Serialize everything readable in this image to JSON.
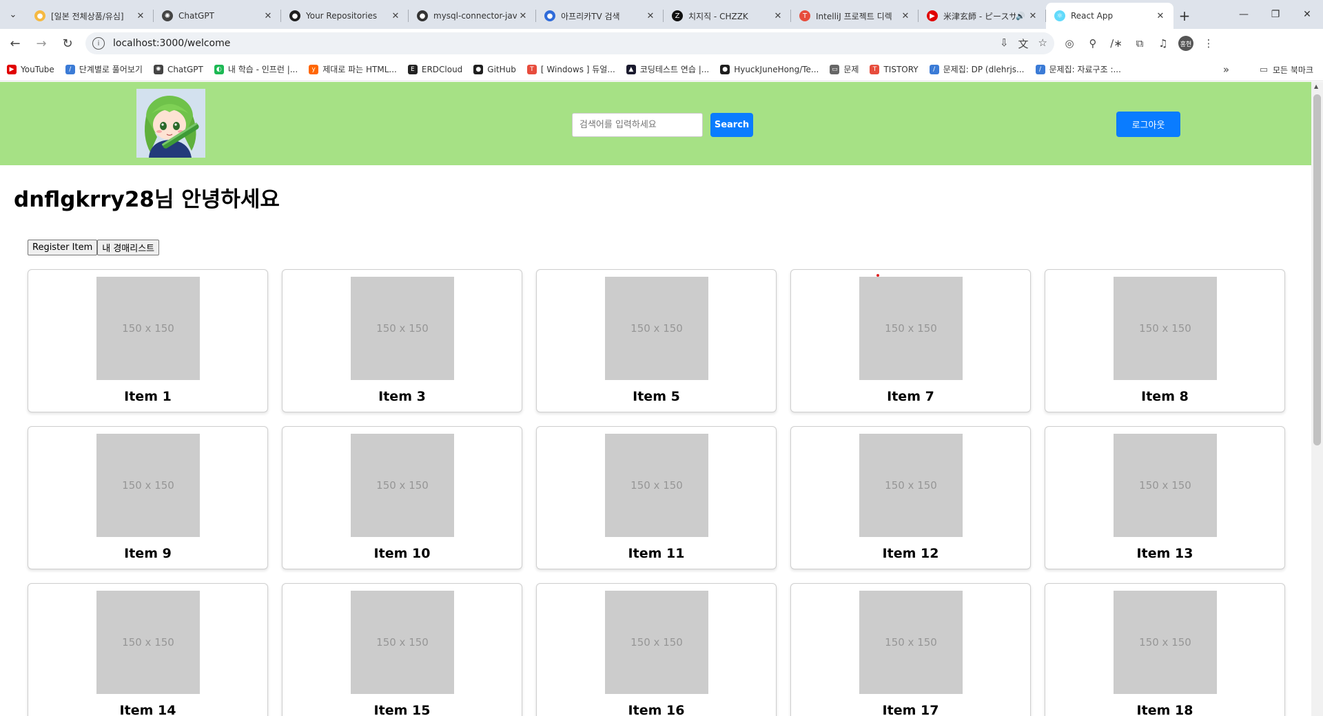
{
  "browser": {
    "tabs": [
      {
        "title": "[일본 전체상품/유심]",
        "favicon_color": "#f5b942",
        "favicon_glyph": "●"
      },
      {
        "title": "ChatGPT",
        "favicon_color": "#444444",
        "favicon_glyph": "✺"
      },
      {
        "title": "Your Repositories",
        "favicon_color": "#1f1f1f",
        "favicon_glyph": "●"
      },
      {
        "title": "mysql-connector-java",
        "favicon_color": "#333333",
        "favicon_glyph": "●"
      },
      {
        "title": "아프리카TV 검색",
        "favicon_color": "#2f6bd9",
        "favicon_glyph": "●"
      },
      {
        "title": "치지직 - CHZZK",
        "favicon_color": "#111111",
        "favicon_glyph": "Z"
      },
      {
        "title": "IntelliJ 프로젝트 디렉",
        "favicon_color": "#e74c3c",
        "favicon_glyph": "T"
      },
      {
        "title": "米津玄師 - ピースサイン",
        "favicon_color": "#e00000",
        "favicon_glyph": "▶",
        "audio": true
      },
      {
        "title": "React App",
        "favicon_color": "#61dafb",
        "favicon_glyph": "⚛",
        "active": true
      }
    ],
    "url": "localhost:3000/welcome",
    "profile_initial": "홍현",
    "bookmarks": [
      {
        "label": "YouTube",
        "color": "#e00000",
        "glyph": "▶"
      },
      {
        "label": "단계별로 풀어보기",
        "color": "#3b7bd6",
        "glyph": "/"
      },
      {
        "label": "ChatGPT",
        "color": "#444444",
        "glyph": "✺"
      },
      {
        "label": "내 학습 - 인프런 |...",
        "color": "#1db954",
        "glyph": "◐"
      },
      {
        "label": "제대로 파는 HTML...",
        "color": "#ff6600",
        "glyph": "y"
      },
      {
        "label": "ERDCloud",
        "color": "#222222",
        "glyph": "E"
      },
      {
        "label": "GitHub",
        "color": "#1f1f1f",
        "glyph": "●"
      },
      {
        "label": "[ Windows ] 듀얼...",
        "color": "#e74c3c",
        "glyph": "T"
      },
      {
        "label": "코딩테스트 연습 |...",
        "color": "#1a1a2e",
        "glyph": "▲"
      },
      {
        "label": "HyuckJuneHong/Te...",
        "color": "#1f1f1f",
        "glyph": "●"
      },
      {
        "label": "문제",
        "color": "#666666",
        "glyph": "▭"
      },
      {
        "label": "TISTORY",
        "color": "#e74c3c",
        "glyph": "T"
      },
      {
        "label": "문제집: DP (dlehrjs...",
        "color": "#3b7bd6",
        "glyph": "/"
      },
      {
        "label": "문제집: 자료구조 :...",
        "color": "#3b7bd6",
        "glyph": "/"
      }
    ],
    "all_bookmarks_label": "모든 북마크"
  },
  "header": {
    "search_placeholder": "검색어를 입력하세요",
    "search_button": "Search",
    "logout_button": "로그아웃",
    "background_color": "#a6e185",
    "button_color": "#0a7cff"
  },
  "main": {
    "welcome_text": "dnflgkrry28님 안녕하세요",
    "register_button": "Register Item",
    "my_auction_button": "내 경매리스트",
    "placeholder_text": "150 x 150",
    "items": [
      {
        "title": "Item 1"
      },
      {
        "title": "Item 3"
      },
      {
        "title": "Item 5"
      },
      {
        "title": "Item 7"
      },
      {
        "title": "Item 8"
      },
      {
        "title": "Item 9"
      },
      {
        "title": "Item 10"
      },
      {
        "title": "Item 11"
      },
      {
        "title": "Item 12"
      },
      {
        "title": "Item 13"
      },
      {
        "title": "Item 14"
      },
      {
        "title": "Item 15"
      },
      {
        "title": "Item 16"
      },
      {
        "title": "Item 17"
      },
      {
        "title": "Item 18"
      }
    ]
  }
}
